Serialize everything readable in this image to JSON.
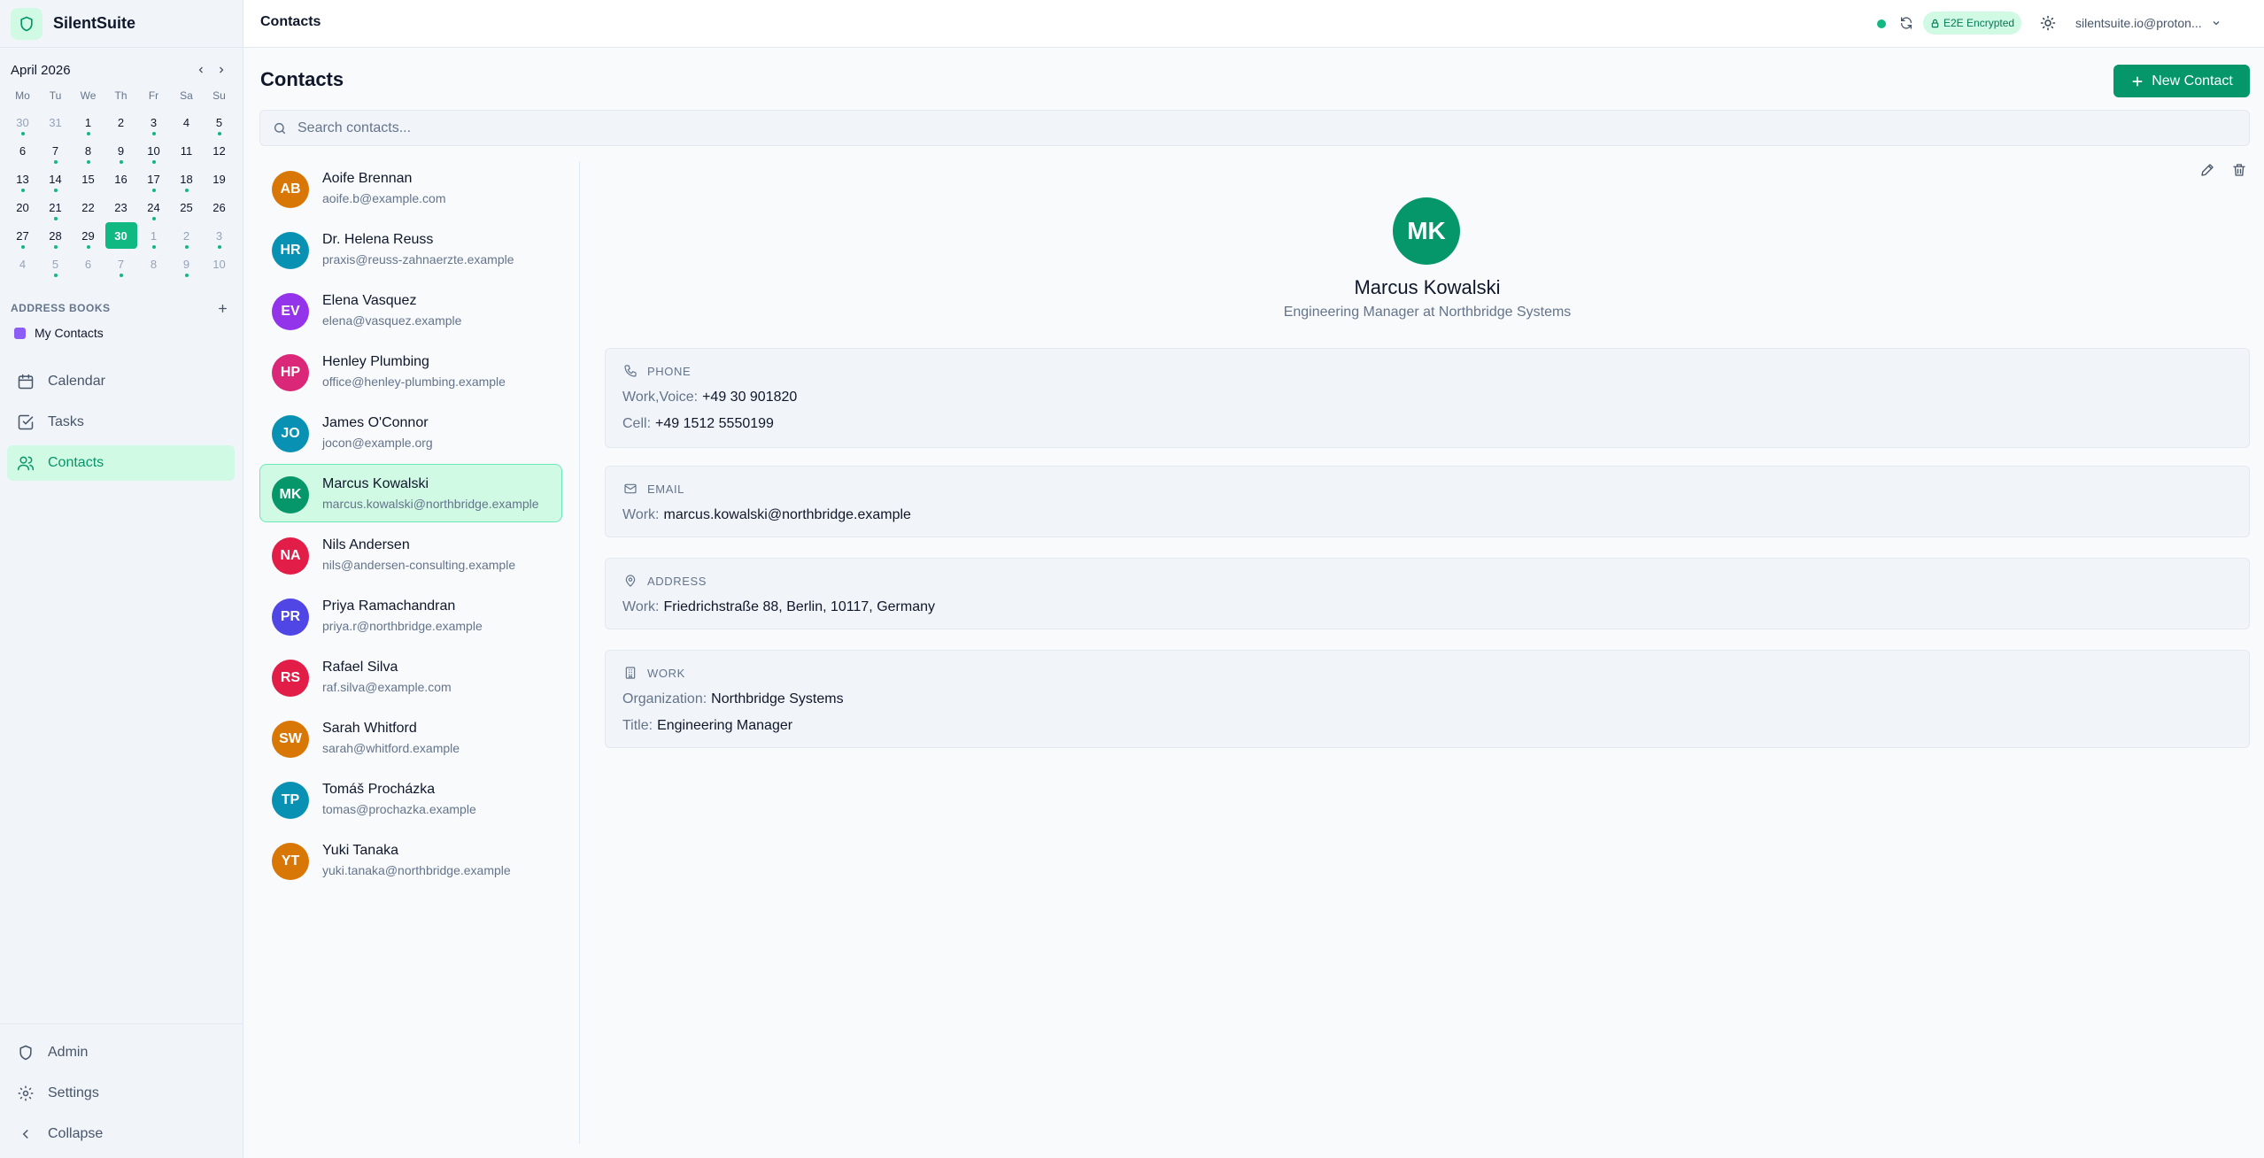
{
  "app": {
    "name": "SilentSuite"
  },
  "topbar": {
    "title": "Contacts",
    "badge": "E2E Encrypted",
    "account": "silentsuite.io@proton..."
  },
  "calendar": {
    "month": "April 2026",
    "weekdays": [
      "Mo",
      "Tu",
      "We",
      "Th",
      "Fr",
      "Sa",
      "Su"
    ],
    "days": [
      {
        "d": "30",
        "muted": true,
        "dot": true
      },
      {
        "d": "31",
        "muted": true,
        "dot": false
      },
      {
        "d": "1",
        "muted": false,
        "dot": true
      },
      {
        "d": "2",
        "muted": false,
        "dot": false
      },
      {
        "d": "3",
        "muted": false,
        "dot": true
      },
      {
        "d": "4",
        "muted": false,
        "dot": false
      },
      {
        "d": "5",
        "muted": false,
        "dot": true
      },
      {
        "d": "6",
        "muted": false,
        "dot": false
      },
      {
        "d": "7",
        "muted": false,
        "dot": true
      },
      {
        "d": "8",
        "muted": false,
        "dot": true
      },
      {
        "d": "9",
        "muted": false,
        "dot": true
      },
      {
        "d": "10",
        "muted": false,
        "dot": true
      },
      {
        "d": "11",
        "muted": false,
        "dot": false
      },
      {
        "d": "12",
        "muted": false,
        "dot": false
      },
      {
        "d": "13",
        "muted": false,
        "dot": true
      },
      {
        "d": "14",
        "muted": false,
        "dot": true
      },
      {
        "d": "15",
        "muted": false,
        "dot": false
      },
      {
        "d": "16",
        "muted": false,
        "dot": false
      },
      {
        "d": "17",
        "muted": false,
        "dot": true
      },
      {
        "d": "18",
        "muted": false,
        "dot": true
      },
      {
        "d": "19",
        "muted": false,
        "dot": false
      },
      {
        "d": "20",
        "muted": false,
        "dot": false
      },
      {
        "d": "21",
        "muted": false,
        "dot": true
      },
      {
        "d": "22",
        "muted": false,
        "dot": false
      },
      {
        "d": "23",
        "muted": false,
        "dot": false
      },
      {
        "d": "24",
        "muted": false,
        "dot": true
      },
      {
        "d": "25",
        "muted": false,
        "dot": false
      },
      {
        "d": "26",
        "muted": false,
        "dot": false
      },
      {
        "d": "27",
        "muted": false,
        "dot": true
      },
      {
        "d": "28",
        "muted": false,
        "dot": true
      },
      {
        "d": "29",
        "muted": false,
        "dot": true
      },
      {
        "d": "30",
        "muted": false,
        "dot": false,
        "today": true
      },
      {
        "d": "1",
        "muted": true,
        "dot": true
      },
      {
        "d": "2",
        "muted": true,
        "dot": true
      },
      {
        "d": "3",
        "muted": true,
        "dot": true
      },
      {
        "d": "4",
        "muted": true,
        "dot": false
      },
      {
        "d": "5",
        "muted": true,
        "dot": true
      },
      {
        "d": "6",
        "muted": true,
        "dot": false
      },
      {
        "d": "7",
        "muted": true,
        "dot": true
      },
      {
        "d": "8",
        "muted": true,
        "dot": false
      },
      {
        "d": "9",
        "muted": true,
        "dot": true
      },
      {
        "d": "10",
        "muted": true,
        "dot": false
      }
    ]
  },
  "address_books": {
    "title": "ADDRESS BOOKS",
    "items": [
      {
        "label": "My Contacts",
        "color": "#8b5cf6"
      }
    ]
  },
  "nav": {
    "items": [
      {
        "label": "Calendar",
        "icon": "calendar-icon",
        "active": false
      },
      {
        "label": "Tasks",
        "icon": "tasks-icon",
        "active": false
      },
      {
        "label": "Contacts",
        "icon": "users-icon",
        "active": true
      }
    ],
    "bottom": [
      {
        "label": "Admin",
        "icon": "shield-icon"
      },
      {
        "label": "Settings",
        "icon": "gear-icon"
      },
      {
        "label": "Collapse",
        "icon": "chevron-left-icon"
      }
    ]
  },
  "main": {
    "title": "Contacts",
    "new_button": "New Contact",
    "search_placeholder": "Search contacts..."
  },
  "contacts": [
    {
      "initials": "AB",
      "name": "Aoife Brennan",
      "email": "aoife.b@example.com",
      "color": "#d97706"
    },
    {
      "initials": "HR",
      "name": "Dr. Helena Reuss",
      "email": "praxis@reuss-zahnaerzte.example",
      "color": "#0891b2"
    },
    {
      "initials": "EV",
      "name": "Elena Vasquez",
      "email": "elena@vasquez.example",
      "color": "#9333ea"
    },
    {
      "initials": "HP",
      "name": "Henley Plumbing",
      "email": "office@henley-plumbing.example",
      "color": "#db2777"
    },
    {
      "initials": "JO",
      "name": "James O'Connor",
      "email": "jocon@example.org",
      "color": "#0891b2"
    },
    {
      "initials": "MK",
      "name": "Marcus Kowalski",
      "email": "marcus.kowalski@northbridge.example",
      "color": "#059669",
      "selected": true
    },
    {
      "initials": "NA",
      "name": "Nils Andersen",
      "email": "nils@andersen-consulting.example",
      "color": "#e11d48"
    },
    {
      "initials": "PR",
      "name": "Priya Ramachandran",
      "email": "priya.r@northbridge.example",
      "color": "#4f46e5"
    },
    {
      "initials": "RS",
      "name": "Rafael Silva",
      "email": "raf.silva@example.com",
      "color": "#e11d48"
    },
    {
      "initials": "SW",
      "name": "Sarah Whitford",
      "email": "sarah@whitford.example",
      "color": "#d97706"
    },
    {
      "initials": "TP",
      "name": "Tomáš Procházka",
      "email": "tomas@prochazka.example",
      "color": "#0891b2"
    },
    {
      "initials": "YT",
      "name": "Yuki Tanaka",
      "email": "yuki.tanaka@northbridge.example",
      "color": "#d97706"
    }
  ],
  "detail": {
    "initials": "MK",
    "name": "Marcus Kowalski",
    "subtitle": "Engineering Manager at Northbridge Systems",
    "sections": [
      {
        "title": "PHONE",
        "icon": "phone-icon",
        "rows": [
          {
            "label": "Work,Voice:",
            "value": "+49 30 901820"
          },
          {
            "label": "Cell:",
            "value": "+49 1512 5550199"
          }
        ]
      },
      {
        "title": "EMAIL",
        "icon": "mail-icon",
        "rows": [
          {
            "label": "Work:",
            "value": "marcus.kowalski@northbridge.example"
          }
        ]
      },
      {
        "title": "ADDRESS",
        "icon": "map-pin-icon",
        "rows": [
          {
            "label": "Work:",
            "value": "Friedrichstraße 88, Berlin, 10117, Germany"
          }
        ]
      },
      {
        "title": "WORK",
        "icon": "building-icon",
        "rows": [
          {
            "label": "Organization:",
            "value": "Northbridge Systems"
          },
          {
            "label": "Title:",
            "value": "Engineering Manager"
          }
        ]
      }
    ]
  },
  "colors": {
    "accent": "#059669",
    "accent_light": "#d1fae5",
    "event_dot": "#10b981"
  }
}
